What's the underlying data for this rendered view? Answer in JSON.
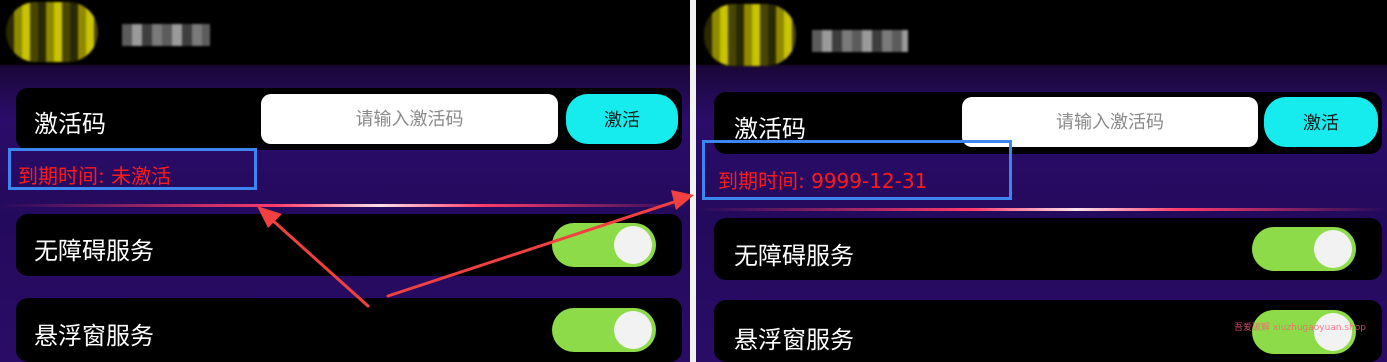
{
  "colors": {
    "accent_cyan": "#16ecee",
    "expiry_red": "#ff1a1a",
    "toggle_green": "#8edb4a",
    "highlight_blue": "#3d86f0",
    "arrow_red": "#f04040"
  },
  "left": {
    "activation": {
      "label": "激活码",
      "placeholder": "请输入激活码",
      "button": "激活"
    },
    "expiry": "到期时间: 未激活",
    "services": [
      {
        "label": "无障碍服务",
        "enabled": true
      },
      {
        "label": "悬浮窗服务",
        "enabled": true
      }
    ]
  },
  "right": {
    "activation": {
      "label": "激活码",
      "placeholder": "请输入激活码",
      "button": "激活"
    },
    "expiry": "到期时间: 9999-12-31",
    "services": [
      {
        "label": "无障碍服务",
        "enabled": true
      },
      {
        "label": "悬浮窗服务",
        "enabled": true
      }
    ],
    "watermark": "吾爱破解 xiuzhugaoyuan.shop"
  },
  "annotation": {
    "icon": "red-arrows-icon"
  }
}
